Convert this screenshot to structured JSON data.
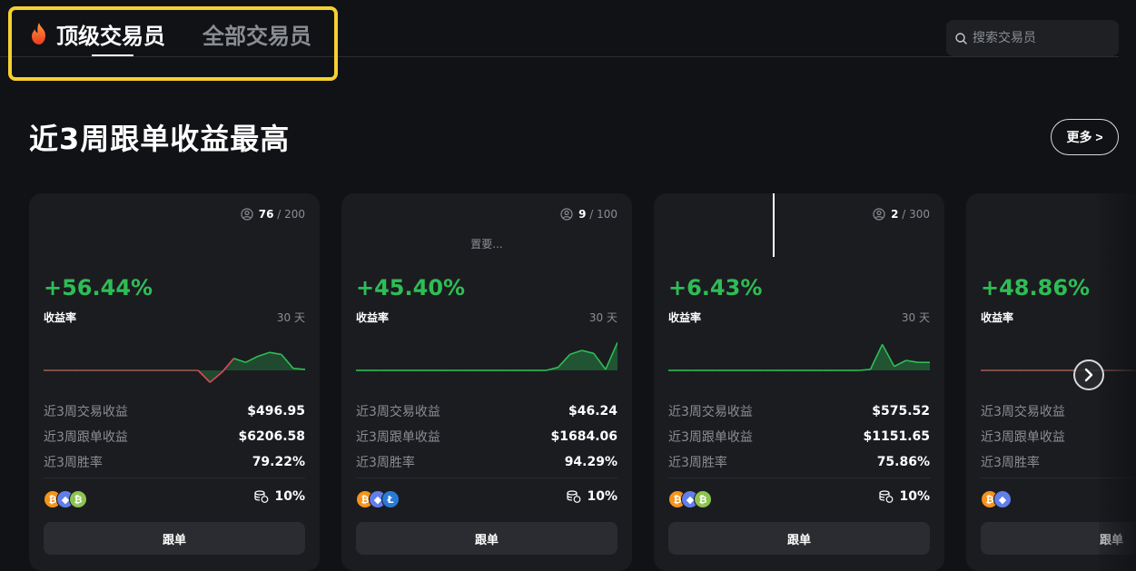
{
  "tabs": {
    "top_traders": "顶级交易员",
    "all_traders": "全部交易员"
  },
  "search": {
    "placeholder": "搜索交易员"
  },
  "section": {
    "title": "近3周跟单收益最高",
    "more_label": "更多 >"
  },
  "cards": [
    {
      "followers_current": "76",
      "followers_max": "200",
      "note": "",
      "roi": "+56.44%",
      "roi_label": "收益率",
      "period": "30 天",
      "sparkline": [
        0,
        0,
        0,
        0,
        0,
        0,
        0,
        0,
        0,
        0,
        0,
        0,
        0,
        0,
        -0.6,
        -0.1,
        0.6,
        0.4,
        0.7,
        0.9,
        0.8,
        0.1,
        0.05
      ],
      "stats": [
        {
          "label": "近3周交易收益",
          "value": "$496.95"
        },
        {
          "label": "近3周跟单收益",
          "value": "$6206.58"
        },
        {
          "label": "近3周胜率",
          "value": "79.22%"
        }
      ],
      "coins": [
        "btc",
        "eth",
        "bch"
      ],
      "profit_share": "10%",
      "copy_label": "跟单"
    },
    {
      "followers_current": "9",
      "followers_max": "100",
      "note": "置要...",
      "roi": "+45.40%",
      "roi_label": "收益率",
      "period": "30 天",
      "sparkline": [
        0,
        0,
        0,
        0,
        0,
        0,
        0,
        0,
        0,
        0,
        0,
        0,
        0,
        0,
        0,
        0,
        0,
        0.15,
        0.8,
        1.0,
        0.85,
        0.05,
        1.4
      ],
      "stats": [
        {
          "label": "近3周交易收益",
          "value": "$46.24"
        },
        {
          "label": "近3周跟单收益",
          "value": "$1684.06"
        },
        {
          "label": "近3周胜率",
          "value": "94.29%"
        }
      ],
      "coins": [
        "btc",
        "eth",
        "ltc"
      ],
      "profit_share": "10%",
      "copy_label": "跟单"
    },
    {
      "followers_current": "2",
      "followers_max": "300",
      "note": "",
      "roi": "+6.43%",
      "roi_label": "收益率",
      "period": "30 天",
      "sparkline": [
        0,
        0,
        0,
        0,
        0,
        0,
        0,
        0,
        0,
        0,
        0,
        0,
        0,
        0,
        0,
        0,
        0,
        0.05,
        1.3,
        0.2,
        0.5,
        0.4,
        0.4
      ],
      "stats": [
        {
          "label": "近3周交易收益",
          "value": "$575.52"
        },
        {
          "label": "近3周跟单收益",
          "value": "$1151.65"
        },
        {
          "label": "近3周胜率",
          "value": "75.86%"
        }
      ],
      "coins": [
        "btc",
        "eth",
        "bch"
      ],
      "profit_share": "10%",
      "copy_label": "跟单"
    },
    {
      "followers_current": "",
      "followers_max": "",
      "note": "",
      "roi": "+48.86%",
      "roi_label": "收益率",
      "period": "",
      "sparkline": [
        0,
        0,
        0,
        0,
        0,
        0,
        0,
        0,
        0,
        0,
        0,
        0,
        0,
        0,
        0,
        0,
        0,
        0,
        0,
        0,
        0,
        0,
        0
      ],
      "stats": [
        {
          "label": "近3周交易收益",
          "value": ""
        },
        {
          "label": "近3周跟单收益",
          "value": ""
        },
        {
          "label": "近3周胜率",
          "value": ""
        }
      ],
      "coins": [
        "btc",
        "eth"
      ],
      "profit_share": "",
      "copy_label": "跟单"
    }
  ],
  "colors": {
    "positive": "#2ebd55",
    "negative": "#e04a5a",
    "highlight": "#f5d030"
  }
}
